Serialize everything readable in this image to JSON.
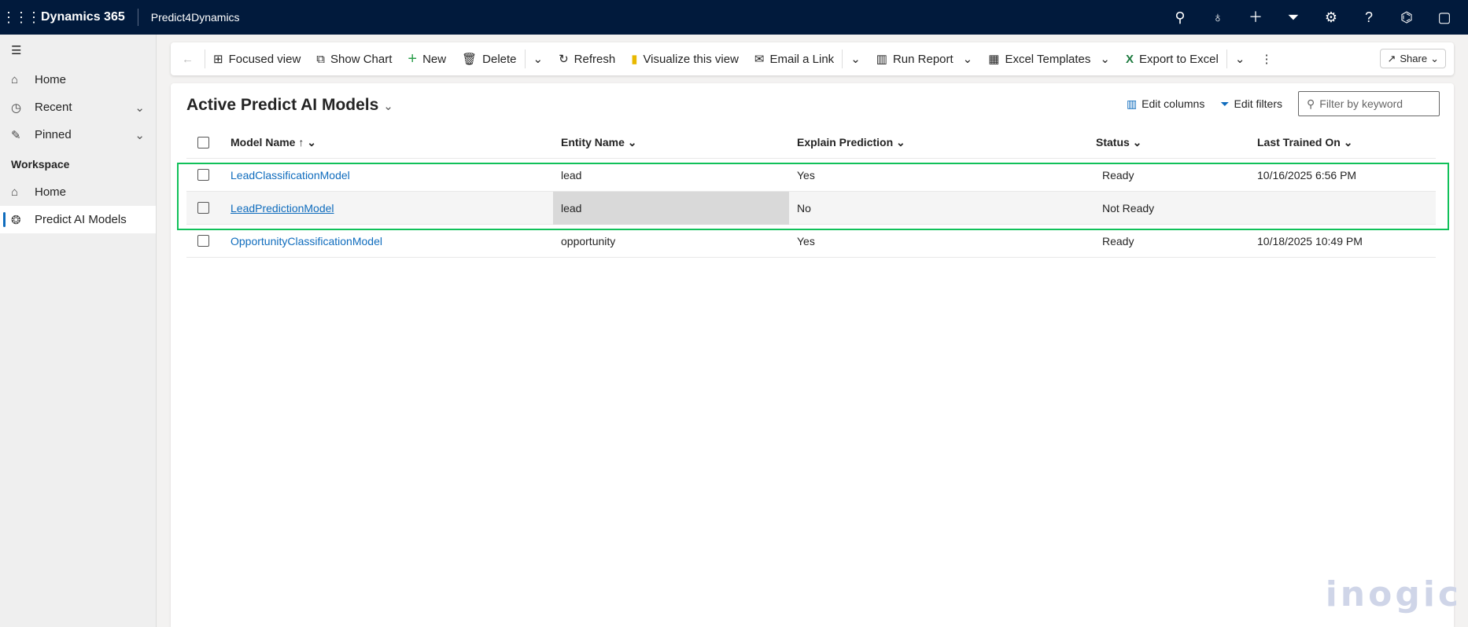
{
  "topbar": {
    "brand": "Dynamics 365",
    "app": "Predict4Dynamics"
  },
  "sidebar": {
    "items": [
      {
        "label": "Home"
      },
      {
        "label": "Recent"
      },
      {
        "label": "Pinned"
      }
    ],
    "section": "Workspace",
    "workspace_items": [
      {
        "label": "Home"
      },
      {
        "label": "Predict AI Models"
      }
    ]
  },
  "toolbar": {
    "focused_view": "Focused view",
    "show_chart": "Show Chart",
    "new": "New",
    "delete": "Delete",
    "refresh": "Refresh",
    "visualize": "Visualize this view",
    "email_link": "Email a Link",
    "run_report": "Run Report",
    "excel_templates": "Excel Templates",
    "export_excel": "Export to Excel",
    "share": "Share"
  },
  "view": {
    "title": "Active Predict AI Models",
    "edit_columns": "Edit columns",
    "edit_filters": "Edit filters",
    "filter_placeholder": "Filter by keyword"
  },
  "columns": [
    "Model Name",
    "Entity Name",
    "Explain Prediction",
    "Status",
    "Last Trained On"
  ],
  "rows": [
    {
      "model": "LeadClassificationModel",
      "entity": "lead",
      "explain": "Yes",
      "status": "Ready",
      "trained": "10/16/2025 6:56 PM"
    },
    {
      "model": "LeadPredictionModel",
      "entity": "lead",
      "explain": "No",
      "status": "Not Ready",
      "trained": ""
    },
    {
      "model": "OpportunityClassificationModel",
      "entity": "opportunity",
      "explain": "Yes",
      "status": "Ready",
      "trained": "10/18/2025 10:49 PM"
    }
  ],
  "watermark": "inogic"
}
